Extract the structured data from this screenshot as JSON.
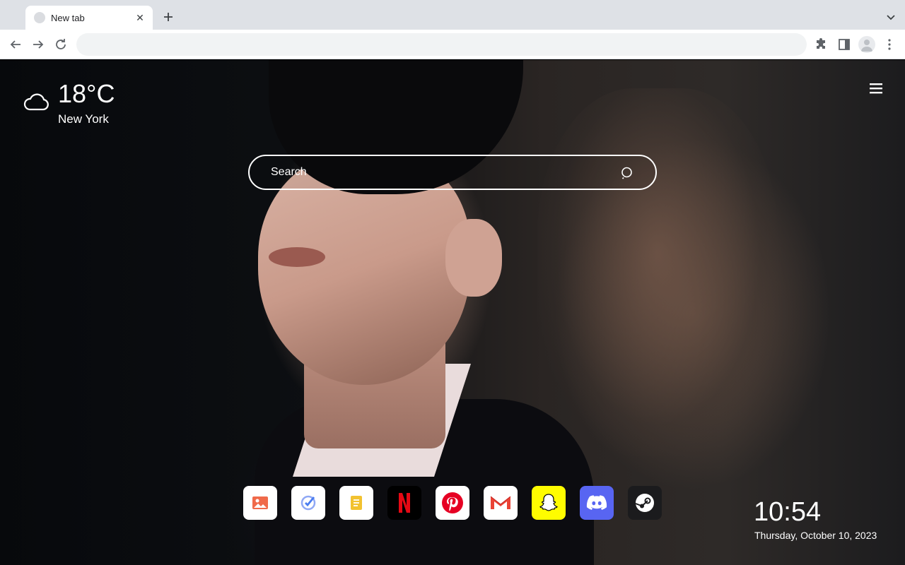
{
  "browser": {
    "tab": {
      "title": "New tab",
      "close_icon": "close-icon"
    },
    "new_tab_icon": "plus-icon",
    "omnibox": {
      "value": "",
      "placeholder": ""
    },
    "colors": {
      "tabstrip": "#dee1e6",
      "toolbar": "#ffffff",
      "omnibox": "#f1f3f4"
    }
  },
  "newtab": {
    "weather": {
      "temperature": "18°C",
      "city": "New York",
      "icon": "cloud-icon"
    },
    "search": {
      "placeholder": "Search"
    },
    "clock": {
      "time": "10:54",
      "date": "Thursday, October 10, 2023"
    },
    "apps": [
      {
        "name": "gallery",
        "icon": "image-icon",
        "bg": "#ffffff",
        "accent": "#f06a4a"
      },
      {
        "name": "tasks",
        "icon": "check-icon",
        "bg": "#ffffff",
        "accent": "#4a7df0"
      },
      {
        "name": "notes",
        "icon": "notes-icon",
        "bg": "#ffffff",
        "accent": "#f2c230"
      },
      {
        "name": "netflix",
        "icon": "netflix-icon",
        "bg": "#000000",
        "accent": "#e50914"
      },
      {
        "name": "pinterest",
        "icon": "pinterest-icon",
        "bg": "#ffffff",
        "accent": "#e60023"
      },
      {
        "name": "gmail",
        "icon": "gmail-icon",
        "bg": "#ffffff",
        "accent": "#ea4335"
      },
      {
        "name": "snapchat",
        "icon": "snapchat-icon",
        "bg": "#fffc00",
        "accent": "#ffffff"
      },
      {
        "name": "discord",
        "icon": "discord-icon",
        "bg": "#5865f2",
        "accent": "#ffffff"
      },
      {
        "name": "steam",
        "icon": "steam-icon",
        "bg": "#1b1b1d",
        "accent": "#ffffff"
      }
    ]
  }
}
